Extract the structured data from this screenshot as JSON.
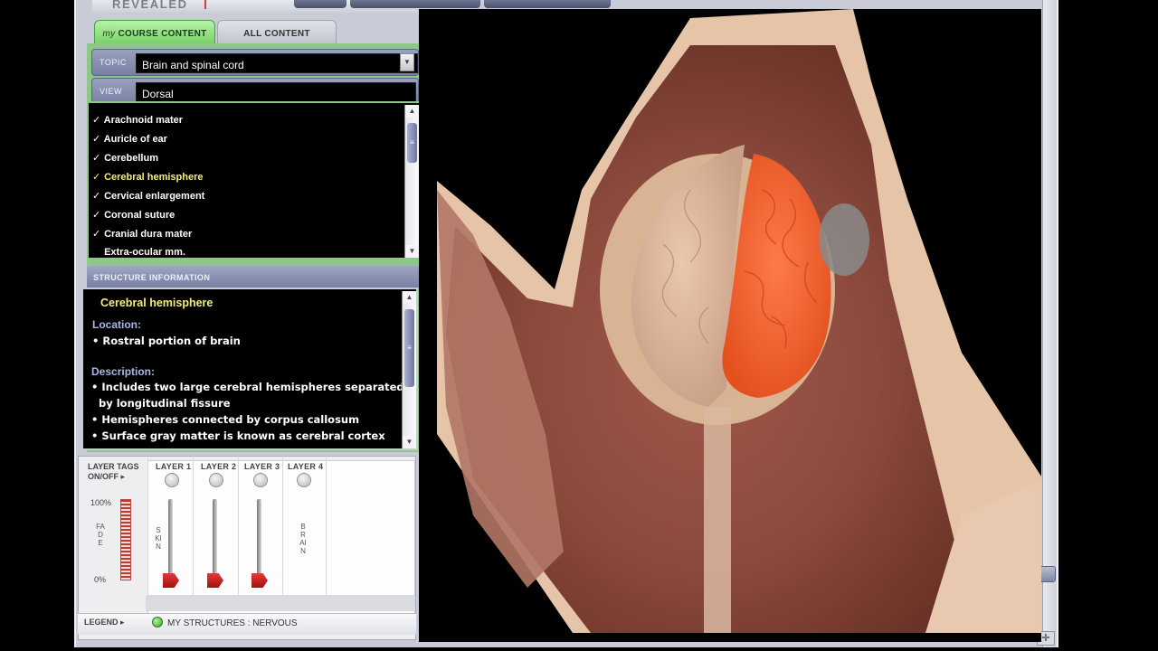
{
  "app": {
    "brand": "REVEALED"
  },
  "tabs": [
    {
      "prefix": "my",
      "label": "COURSE CONTENT",
      "active": true
    },
    {
      "label": "ALL CONTENT",
      "active": false
    }
  ],
  "topic": {
    "label": "TOPIC",
    "value": "Brain and spinal cord"
  },
  "view": {
    "label": "VIEW",
    "value": "Dorsal"
  },
  "structures": {
    "items": [
      {
        "label": "Arachnoid mater",
        "checked": true
      },
      {
        "label": "Auricle of ear",
        "checked": true
      },
      {
        "label": "Cerebellum",
        "checked": true
      },
      {
        "label": "Cerebral hemisphere",
        "checked": true,
        "selected": true
      },
      {
        "label": "Cervical enlargement",
        "checked": true
      },
      {
        "label": "Coronal suture",
        "checked": true
      },
      {
        "label": "Cranial dura mater",
        "checked": true
      },
      {
        "label": "Extra-ocular mm.",
        "checked": false
      }
    ]
  },
  "info": {
    "header": "STRUCTURE INFORMATION",
    "title": "Cerebral hemisphere",
    "location_heading": "Location:",
    "location_lines": [
      "• Rostral portion of brain"
    ],
    "description_heading": "Description:",
    "description_lines": [
      "• Includes two large cerebral hemispheres separated",
      "  by longitudinal fissure",
      "• Hemispheres connected by corpus callosum",
      "• Surface gray matter is known as cerebral cortex"
    ]
  },
  "layers": {
    "tags_label_1": "LAYER TAGS",
    "tags_label_2": "ON/OFF",
    "tags_arrow": "▸",
    "fade_top": "100%",
    "fade_bottom": "0%",
    "fade_word": "FADE",
    "columns": [
      {
        "label": "LAYER 1",
        "name": "SKIN"
      },
      {
        "label": "LAYER 2",
        "name": ""
      },
      {
        "label": "LAYER 3",
        "name": ""
      },
      {
        "label": "LAYER 4",
        "name": "BRAIN"
      }
    ]
  },
  "legend": {
    "label": "LEGEND",
    "arrow": "▸",
    "text": "MY STRUCTURES : NERVOUS"
  },
  "colors": {
    "accent_green": "#8dc889",
    "highlight_yellow": "#f3f07a",
    "highlight_structure": "#f05a28"
  }
}
